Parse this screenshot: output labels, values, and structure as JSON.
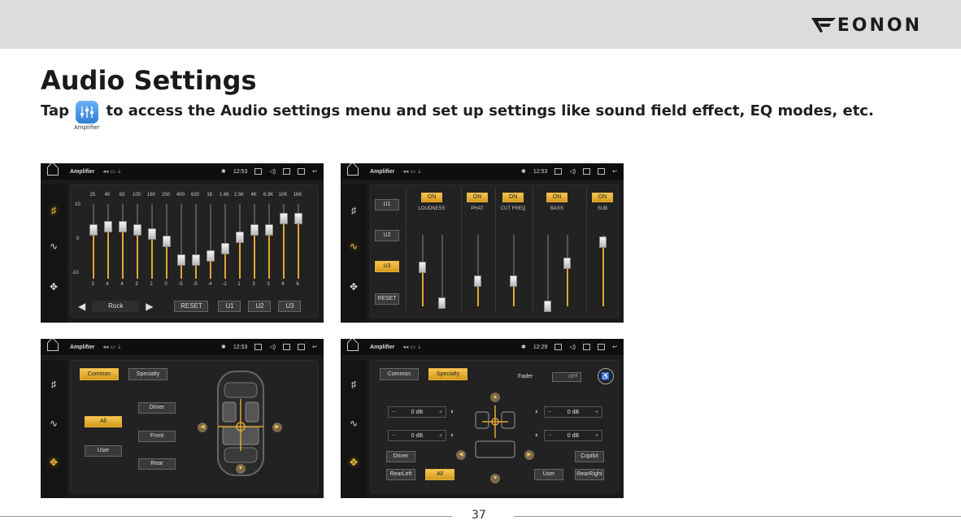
{
  "header": {
    "brand": "EONON"
  },
  "title": "Audio Settings",
  "intro": {
    "before": "Tap",
    "icon_label": "Amplifier",
    "after": "to access the Audio settings menu and set up settings like sound field effect, EQ modes, etc."
  },
  "statusbar": {
    "app_name": "Amplifier",
    "time_a": "12:53",
    "time_b": "12:53",
    "time_c": "12:53",
    "time_d": "12:29"
  },
  "eq": {
    "freqs": [
      "25",
      "40",
      "63",
      "100",
      "160",
      "250",
      "400",
      "630",
      "1K",
      "1.6K",
      "2.5K",
      "4K",
      "6.3K",
      "10K",
      "16K"
    ],
    "values": [
      "3",
      "4",
      "4",
      "3",
      "2",
      "0",
      "-5",
      "-5",
      "-4",
      "-2",
      "1",
      "3",
      "3",
      "6",
      "6"
    ],
    "scale_top": "10",
    "scale_mid": "0",
    "scale_bot": "-10",
    "preset": "Rock",
    "reset": "RESET",
    "u1": "U1",
    "u2": "U2",
    "u3": "U3"
  },
  "tone": {
    "u1": "U1",
    "u2": "U2",
    "u3": "U3",
    "reset": "RESET",
    "on": "ON",
    "labels": [
      "LOUDNESS",
      "PHAT",
      "CUT FREQ",
      "BASS",
      "SUB"
    ]
  },
  "field_a": {
    "tab_common": "Common",
    "tab_specialty": "Specialty",
    "btn_all": "All",
    "btn_user": "User",
    "btn_driver": "Driver",
    "btn_front": "Front",
    "btn_rear": "Rear"
  },
  "field_b": {
    "tab_common": "Common",
    "tab_specialty": "Specialty",
    "fader": "Fader",
    "off": "OFF",
    "db1": "0 dB",
    "db2": "0 dB",
    "db3": "0 dB",
    "db4": "0 dB",
    "btn_driver": "Driver",
    "btn_rearleft": "RearLeft",
    "btn_all": "All",
    "btn_copilot": "Copilot",
    "btn_user": "User",
    "btn_rearright": "RearRight"
  },
  "page_number": "37",
  "colors": {
    "accent": "#e2a531",
    "topbar": "#dcdcdc",
    "screen": "#1b1b1b"
  }
}
